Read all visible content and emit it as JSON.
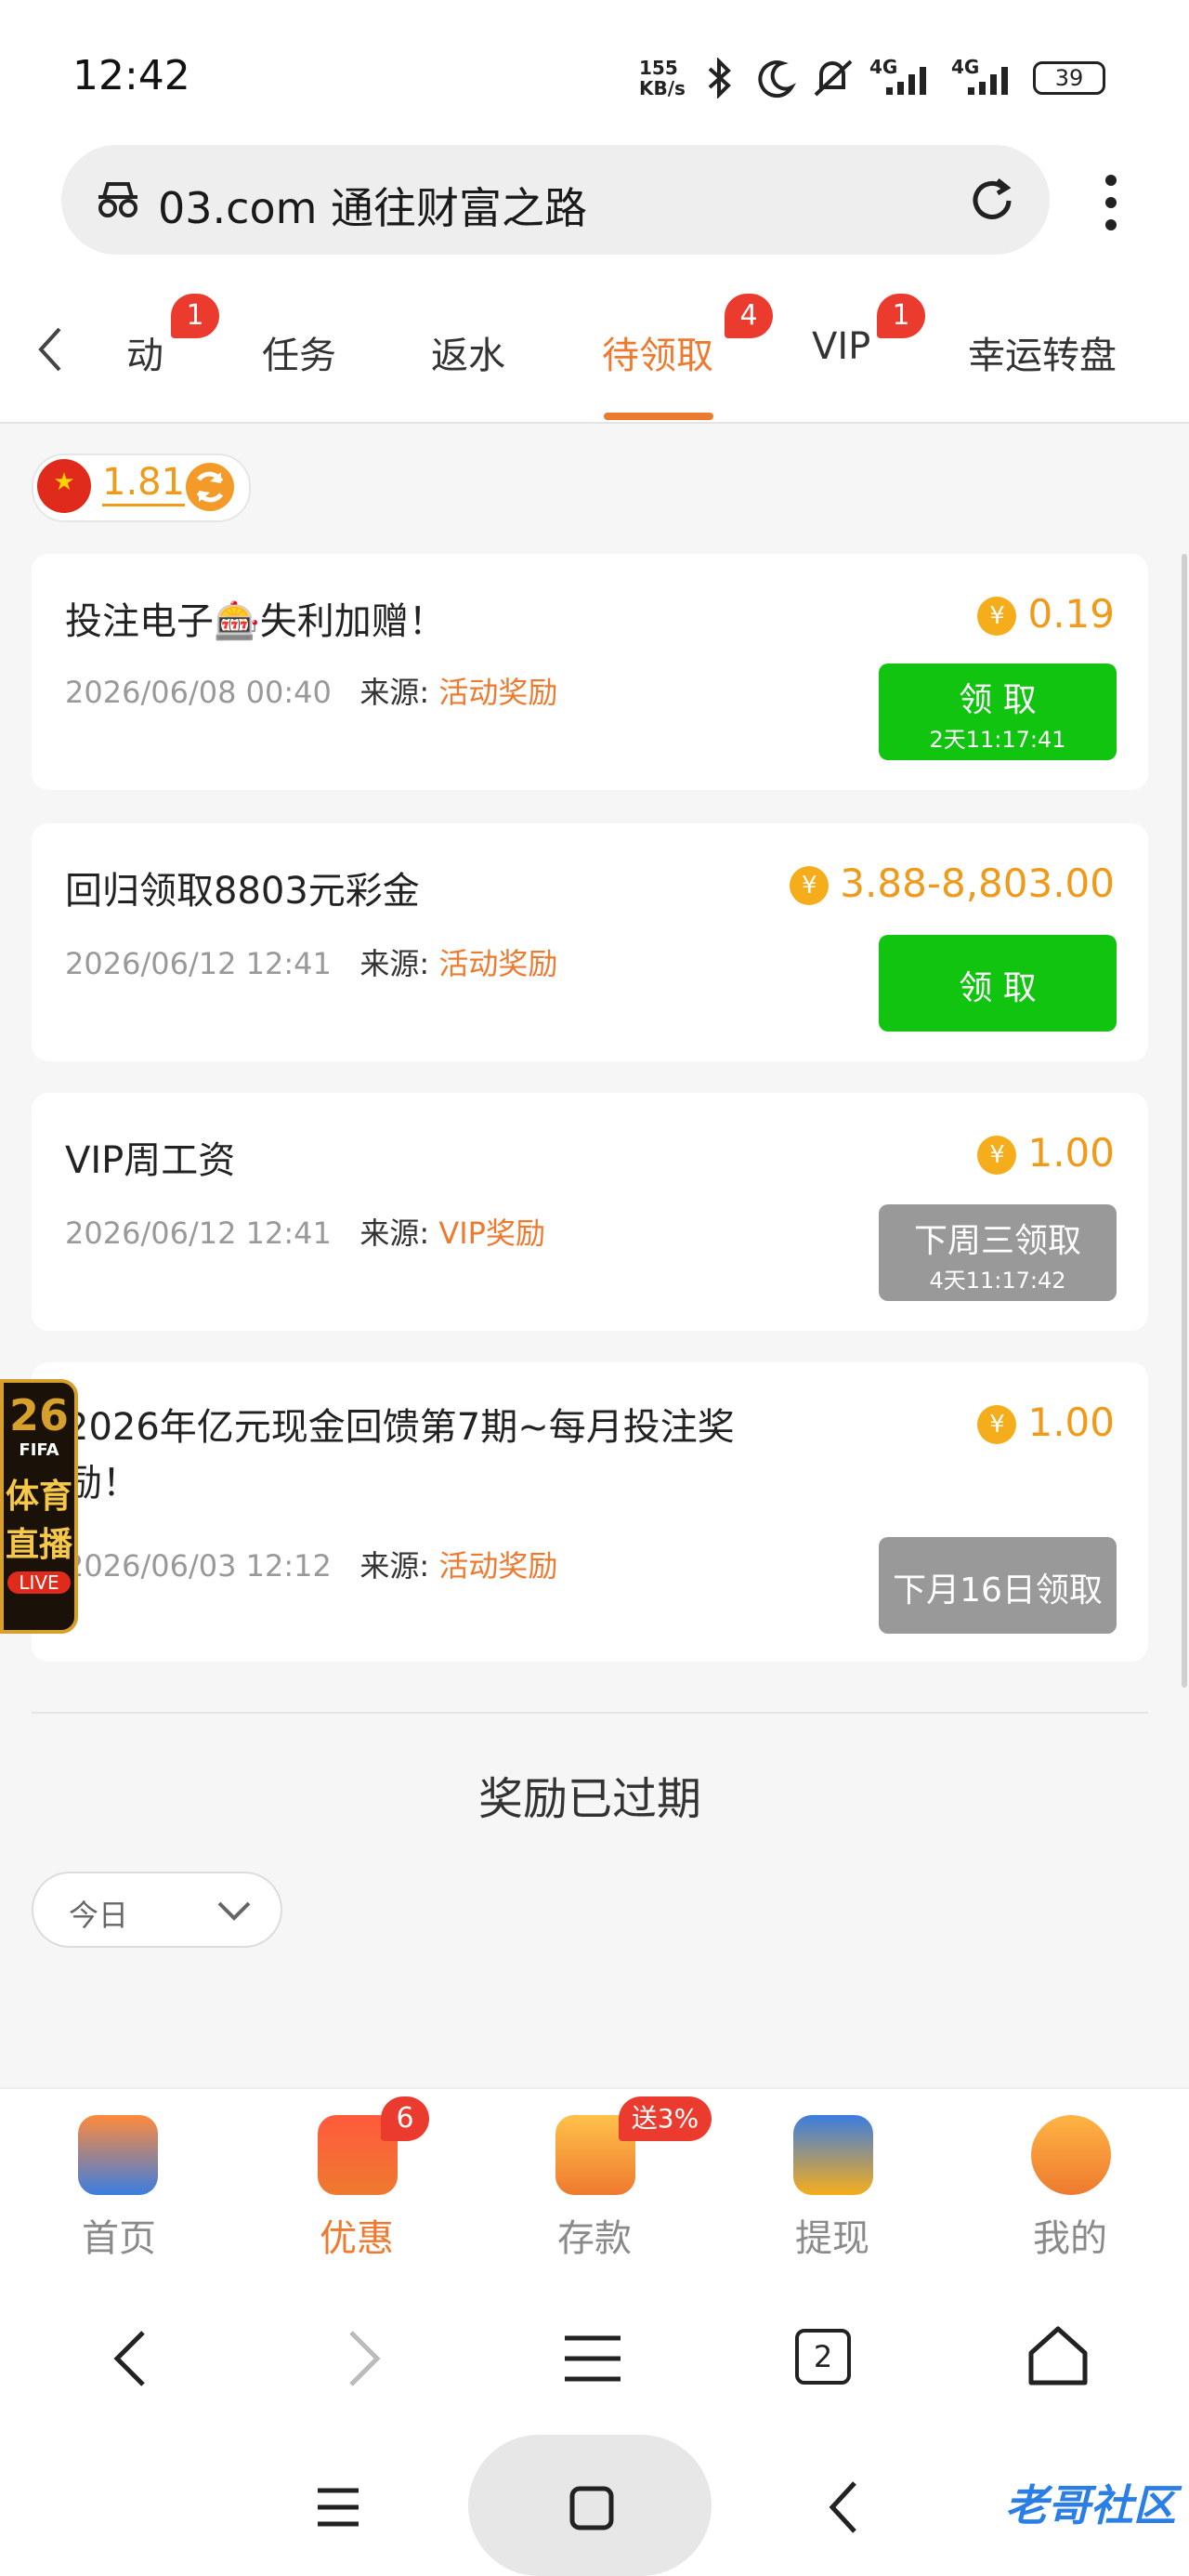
{
  "status_bar": {
    "time": "12:42",
    "speed": "155\nKB/s",
    "net1": "4G",
    "net2": "4G",
    "battery": "39"
  },
  "url_bar": {
    "text": "03.com 通往财富之路"
  },
  "tabs": [
    {
      "label": "动",
      "badge": "1"
    },
    {
      "label": "任务",
      "badge": ""
    },
    {
      "label": "返水",
      "badge": ""
    },
    {
      "label": "待领取",
      "badge": "4",
      "active": true
    },
    {
      "label": "VIP",
      "badge": "1"
    },
    {
      "label": "幸运转盘",
      "badge": ""
    }
  ],
  "balance": {
    "value": "1.81"
  },
  "rewards": [
    {
      "title": "投注电子🎰失利加赠！",
      "date": "2026/06/08 00:40",
      "source_label": "来源:",
      "source": "活动奖励",
      "amount": "0.19",
      "button": "领 取",
      "button_sub": "2天11:17:41",
      "button_color": "#10c410"
    },
    {
      "title": "回归领取8803元彩金",
      "date": "2026/06/12 12:41",
      "source_label": "来源:",
      "source": "活动奖励",
      "amount": "3.88-8,803.00",
      "button": "领 取",
      "button_sub": "",
      "button_color": "#10c410"
    },
    {
      "title": "VIP周工资",
      "date": "2026/06/12 12:41",
      "source_label": "来源:",
      "source": "VIP奖励",
      "amount": "1.00",
      "button": "下周三领取",
      "button_sub": "4天11:17:42",
      "button_color": "#999999"
    },
    {
      "title_line1": "2026年亿元现金回馈第7期~每月投注奖",
      "title_line2": "励！",
      "date": "2026/06/03 12:12",
      "source_label": "来源:",
      "source": "活动奖励",
      "amount": "1.00",
      "button": "下月16日领取",
      "button_sub": "",
      "button_color": "#999999"
    }
  ],
  "expired": {
    "heading": "奖励已过期",
    "filter": "今日"
  },
  "floating_ad": {
    "number": "26",
    "brand": "FIFA",
    "line1": "体育",
    "line2": "直播",
    "live": "LIVE"
  },
  "bottom_nav": [
    {
      "label": "首页",
      "badge": "",
      "active": false,
      "icon": "home-icon"
    },
    {
      "label": "优惠",
      "badge": "6",
      "active": true,
      "icon": "gift-icon"
    },
    {
      "label": "存款",
      "badge": "送3%",
      "active": false,
      "icon": "wallet-icon"
    },
    {
      "label": "提现",
      "badge": "",
      "active": false,
      "icon": "money-bag-icon"
    },
    {
      "label": "我的",
      "badge": "",
      "active": false,
      "icon": "user-icon"
    }
  ],
  "browser_bar": {
    "tab_count": "2"
  },
  "watermark": "老哥社区",
  "colors": {
    "accent": "#ee7a2f",
    "green": "#10c410",
    "badge_red": "#ea3b2e",
    "coin": "#f6ad1b"
  }
}
